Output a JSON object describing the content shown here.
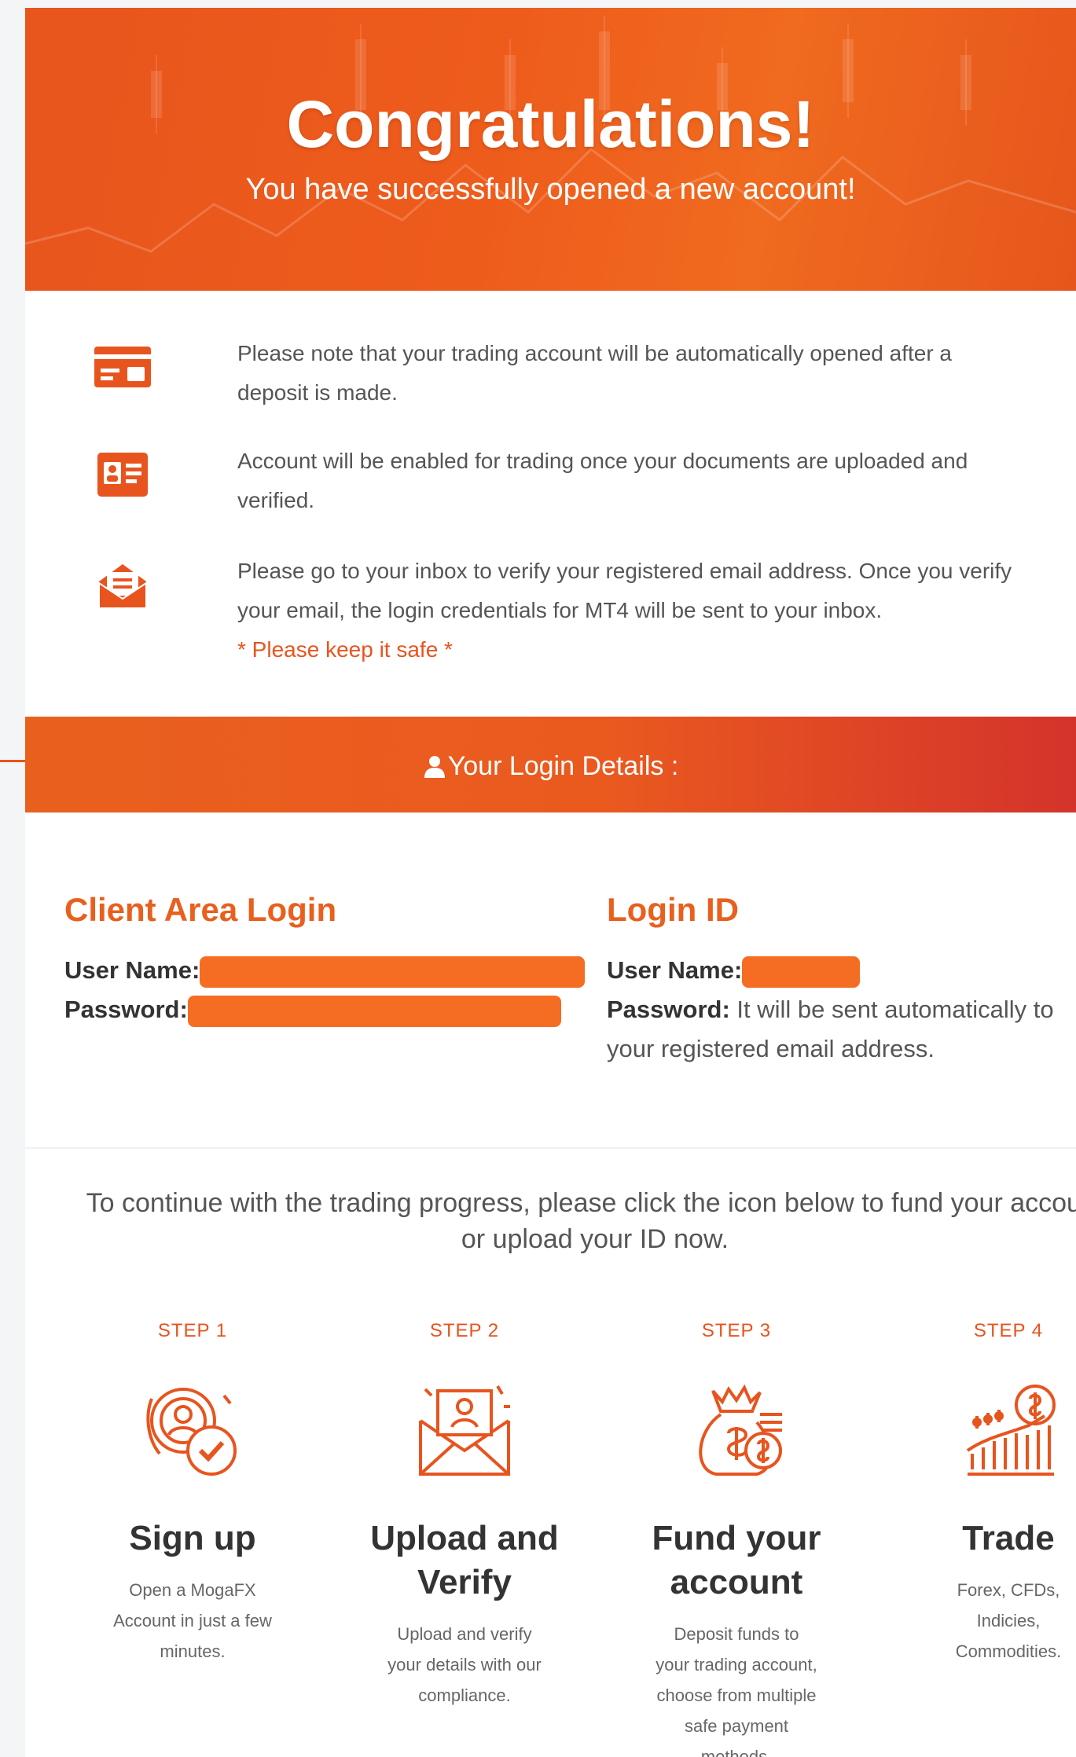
{
  "hero": {
    "title": "Congratulations!",
    "subtitle": "You have successfully opened a new account!"
  },
  "notices": [
    {
      "icon": "credit-card-icon",
      "text": "Please note that your trading account will be automatically opened after a deposit is made."
    },
    {
      "icon": "id-card-icon",
      "text": "Account will be enabled for trading once your documents are uploaded and verified."
    },
    {
      "icon": "email-envelope-icon",
      "text": "Please go to your inbox to verify your registered email address. Once you verify your email, the login credentials for MT4 will be sent to your inbox.",
      "note": "* Please keep it safe *"
    }
  ],
  "login_banner": {
    "label": "Your Login Details :",
    "icon": "user-icon"
  },
  "client_area": {
    "title": "Client Area Login",
    "username_label": "User Name:",
    "password_label": "Password:"
  },
  "login_id": {
    "title": "Login ID",
    "username_label": "User Name:",
    "password_label": "Password:",
    "password_value": "It will be sent automatically to your registered email address."
  },
  "continue_text": "To continue with the trading progress, please click the icon below to fund your account or upload your ID now.",
  "steps": [
    {
      "label": "STEP 1",
      "icon": "user-check-icon",
      "title": "Sign up",
      "desc": "Open a MogaFX Account in just a few minutes."
    },
    {
      "label": "STEP 2",
      "icon": "envelope-upload-icon",
      "title": "Upload and Verify",
      "desc": "Upload and verify your details with our compliance."
    },
    {
      "label": "STEP 3",
      "icon": "money-bag-icon",
      "title": "Fund your account",
      "desc": "Deposit funds to your trading account, choose from multiple safe payment methods."
    },
    {
      "label": "STEP 4",
      "icon": "trade-chart-icon",
      "title": "Trade",
      "desc": "Forex, CFDs, Indicies, Commodities."
    }
  ],
  "colors": {
    "accent": "#e8541e",
    "banner_end": "#d4332b",
    "text": "#555555"
  }
}
